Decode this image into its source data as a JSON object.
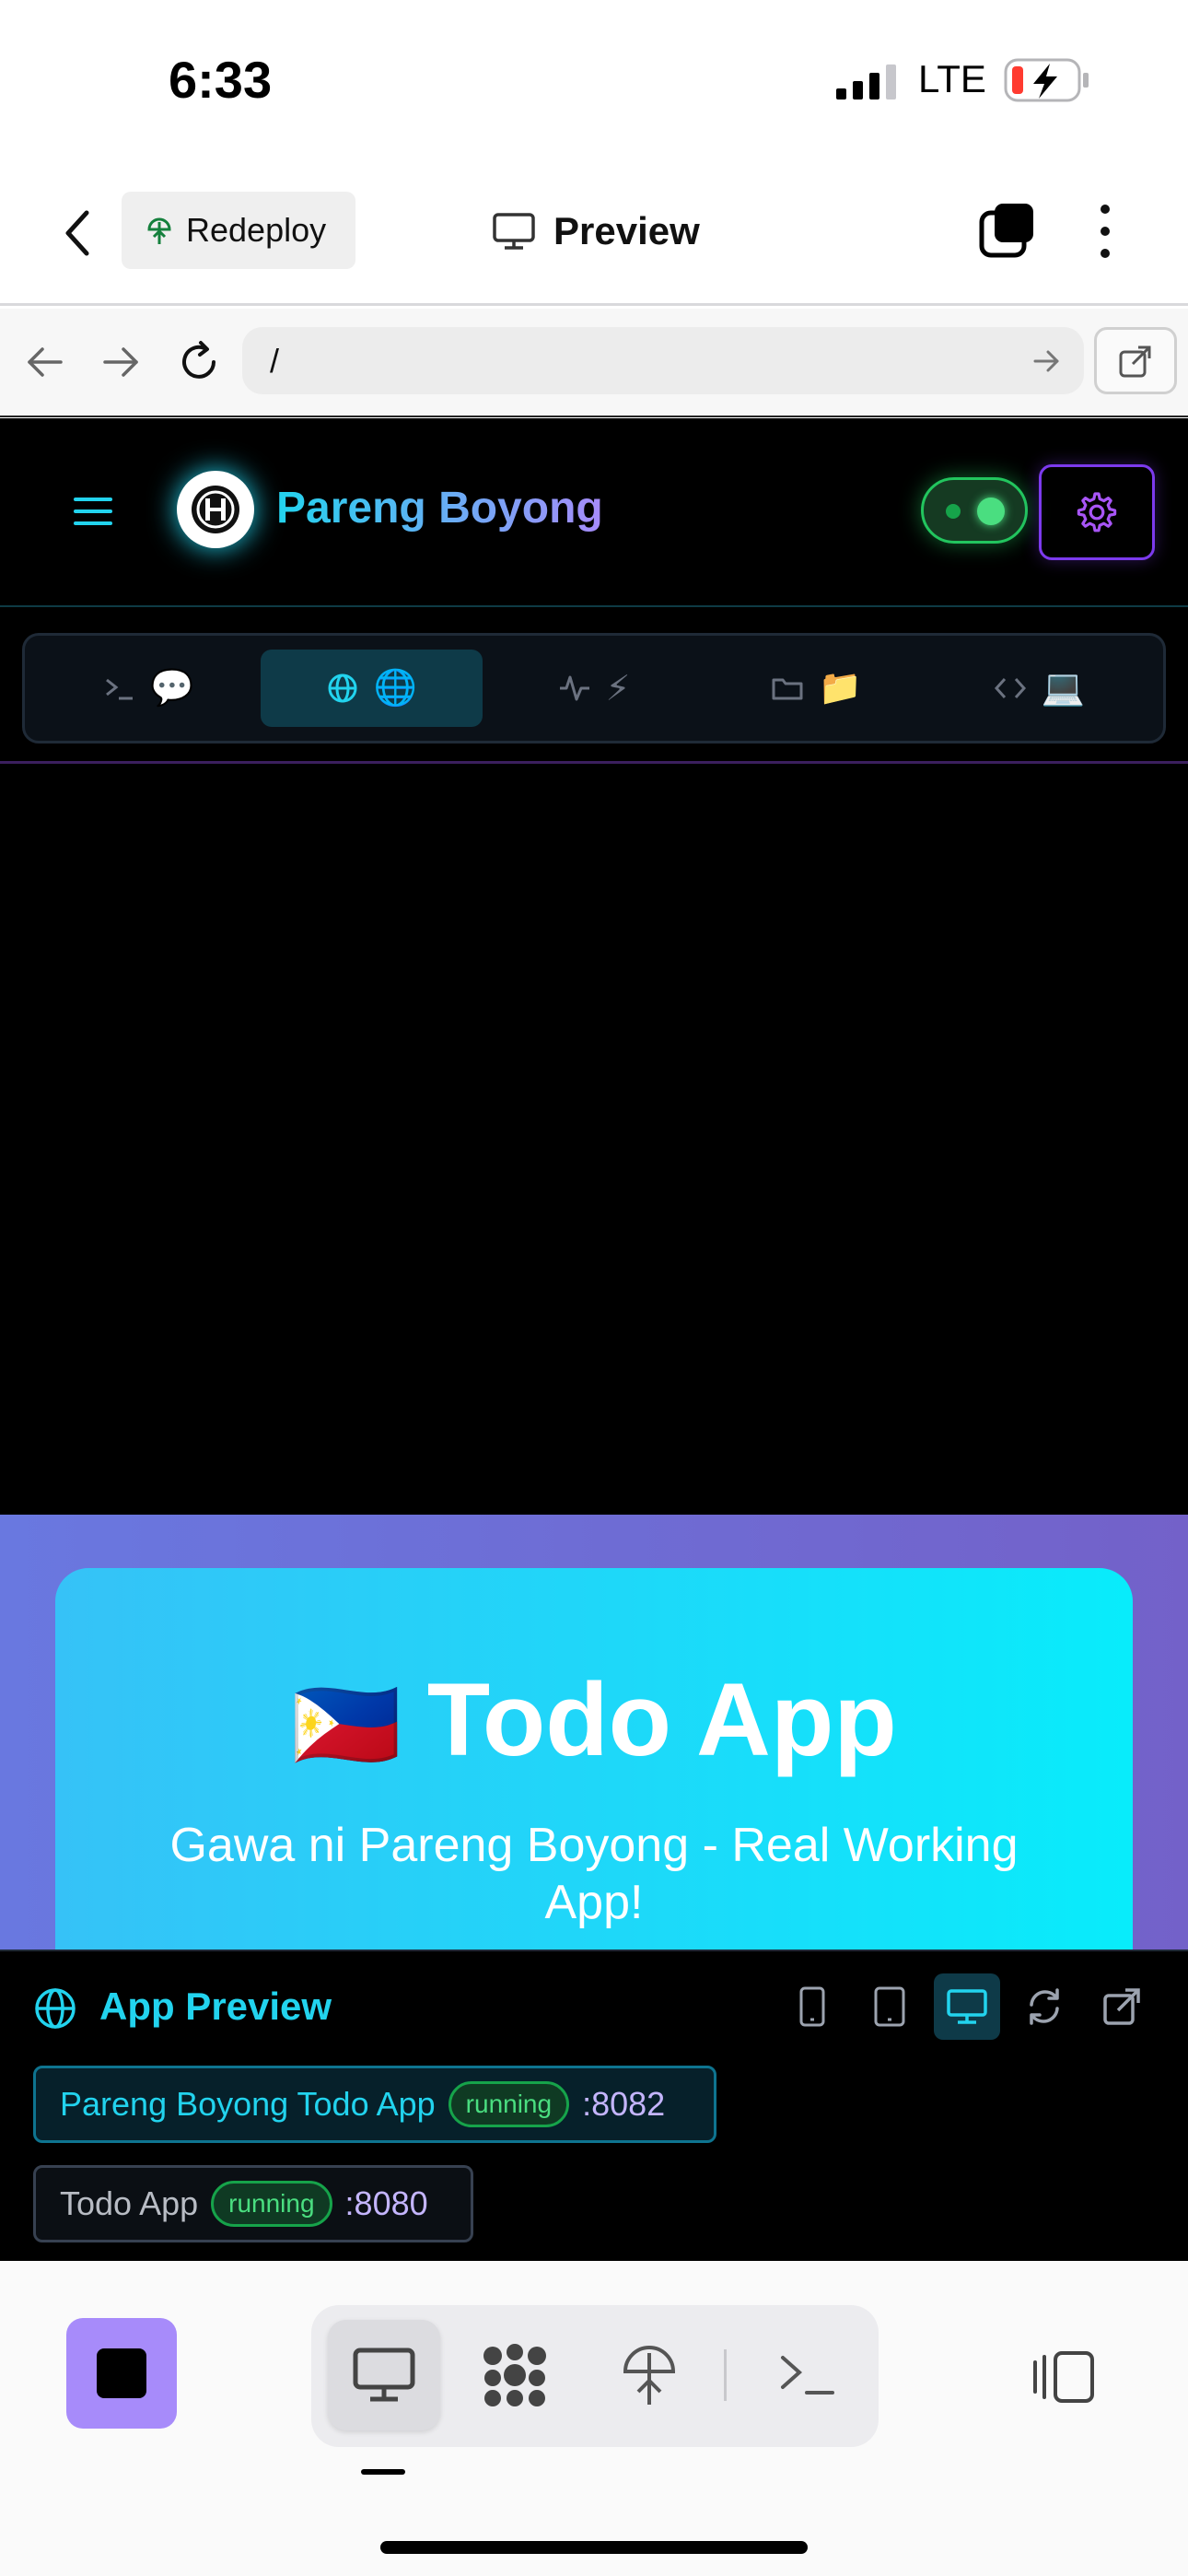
{
  "status_bar": {
    "time": "6:33",
    "network": "LTE"
  },
  "app_bar": {
    "redeploy_label": "Redeploy",
    "title": "Preview"
  },
  "browser": {
    "url": "/"
  },
  "app": {
    "brand": "Pareng Boyong",
    "tabs": [
      {
        "icon": "terminal-icon",
        "emoji": "💬",
        "active": false
      },
      {
        "icon": "globe-icon",
        "emoji": "🌐",
        "active": true
      },
      {
        "icon": "activity-icon",
        "emoji": "⚡",
        "active": false
      },
      {
        "icon": "folder-icon",
        "emoji": "📁",
        "active": false
      },
      {
        "icon": "code-icon",
        "emoji": "💻",
        "active": false
      }
    ]
  },
  "web_preview": {
    "flag": "🇵🇭",
    "title": "Todo App",
    "subtitle": "Gawa ni Pareng Boyong - Real Working App!"
  },
  "panel": {
    "title": "App Preview",
    "processes": [
      {
        "name": "Pareng Boyong Todo App",
        "status": "running",
        "port": ":8082"
      },
      {
        "name": "Todo App",
        "status": "running",
        "port": ":8080"
      }
    ]
  },
  "colors": {
    "accent": "#22d3ee",
    "purple": "#a78bfa",
    "green": "#22c55e"
  }
}
